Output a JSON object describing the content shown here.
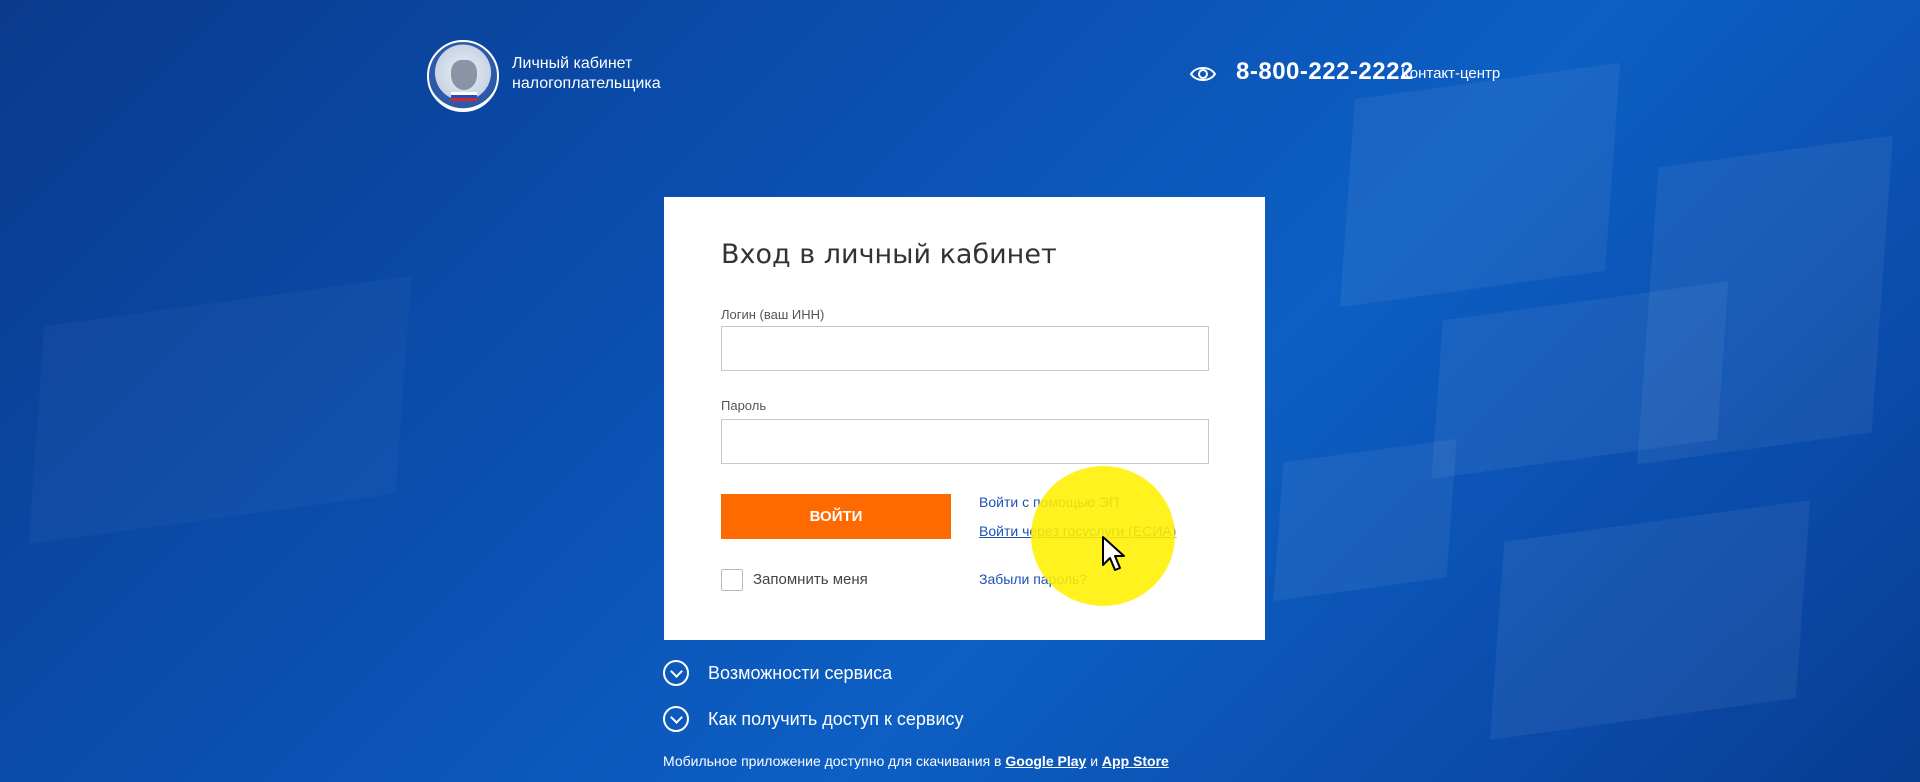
{
  "header": {
    "brand_line1": "Личный кабинет",
    "brand_line2": "налогоплательщика",
    "phone": "8-800-222-2222",
    "contact_center": "Контакт-центр",
    "accessibility_icon": "eye-icon",
    "logo_icon": "fns-emblem-icon"
  },
  "login": {
    "title": "Вход в личный кабинет",
    "login_label": "Логин (ваш ИНН)",
    "login_value": "",
    "password_label": "Пароль",
    "password_value": "",
    "submit_label": "ВОЙТИ",
    "ep_link": "Войти с помощью ЭП",
    "gosuslugi_link": "Войти через госуслуги (ЕСИА)",
    "remember_label": "Запомнить меня",
    "remember_checked": false,
    "forgot_link": "Забыли пароль?"
  },
  "info": {
    "features": "Возможности сервиса",
    "access": "Как получить доступ к сервису",
    "mobile_prefix": "Мобильное приложение доступно для скачивания в",
    "google_play": "Google Play",
    "and": "и",
    "app_store": "App Store"
  },
  "colors": {
    "background": "#0a4fb0",
    "accent": "#ff6a00",
    "link": "#1b52b5",
    "highlight": "#fff000"
  }
}
